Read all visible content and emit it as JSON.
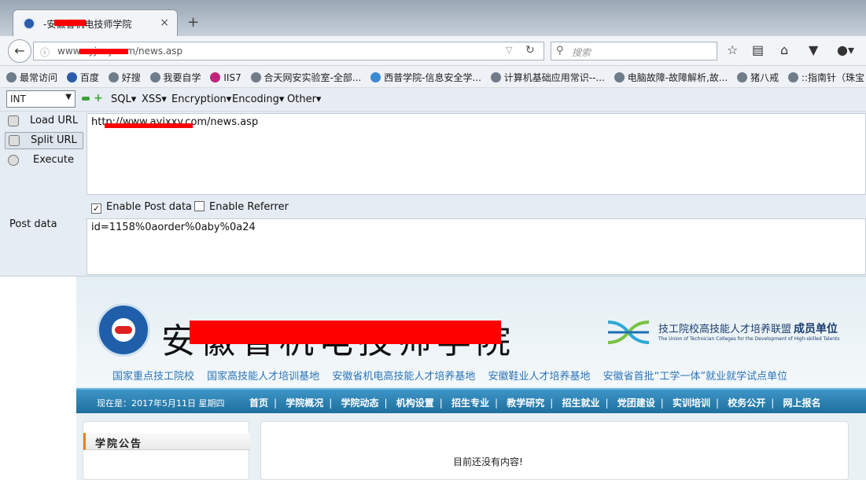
{
  "browser": {
    "tab_title": "-安徽省机电技师学院",
    "new_tab": "+",
    "tab_close": "×",
    "url": "www.ayjxxy.com/news.asp",
    "search_placeholder": "搜索"
  },
  "bookmarks": [
    "最常访问",
    "百度",
    "好搜",
    "我要自学",
    "IIS7",
    "合天网安实验室-全部...",
    "西普学院-信息安全学...",
    "计算机基础应用常识--...",
    "电脑故障-故障解析,故...",
    "猪八戒",
    "::指南针（珠宝"
  ],
  "hackbar": {
    "select_value": "INT",
    "menus": [
      "SQL▾",
      "XSS▾",
      "Encryption▾",
      "Encoding▾",
      "Other▾"
    ],
    "buttons": [
      "Load URL",
      "Split URL",
      "Execute"
    ],
    "url_text": "http://www.ayjxxy.com/news.asp",
    "enable_post": "Enable Post data",
    "enable_referrer": "Enable Referrer",
    "post_label": "Post data",
    "post_text": "id=1158%0aorder%0aby%0a24"
  },
  "site": {
    "school_name": "安徽省机电技师学院",
    "alliance_title": "技工院校高技能人才培养联盟",
    "alliance_sub": "The Union of Technician Colleges for the Development of High-skilled Talents",
    "member": "成员单位",
    "bases": [
      "国家重点技工院校",
      "国家高技能人才培训基地",
      "安徽省机电高技能人才培养基地",
      "安徽鞋业人才培养基地",
      "安徽省首批“工学一体”就业就学试点单位"
    ],
    "date": "现在是：2017年5月11日 星期四",
    "nav": [
      "首页",
      "学院概况",
      "学院动态",
      "机构设置",
      "招生专业",
      "教学研究",
      "招生就业",
      "党团建设",
      "实训培训",
      "校务公开",
      "网上报名"
    ],
    "notice_title": "学院公告",
    "empty_msg": "目前还没有内容!"
  },
  "colors": {
    "accent": "#2b74b6",
    "nav_bg": "#1f6f9f",
    "redaction": "#ff0000"
  }
}
